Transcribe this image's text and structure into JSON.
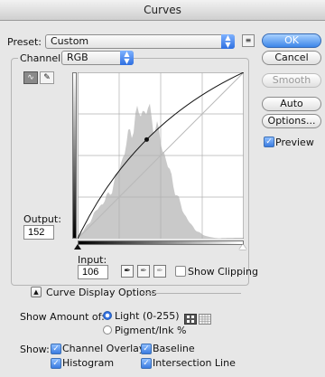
{
  "window": {
    "title": "Curves"
  },
  "preset": {
    "label": "Preset:",
    "value": "Custom"
  },
  "channel": {
    "label": "Channel:",
    "value": "RGB"
  },
  "buttons": {
    "ok": "OK",
    "cancel": "Cancel",
    "smooth": "Smooth",
    "auto": "Auto",
    "options": "Options..."
  },
  "preview": {
    "label": "Preview",
    "checked": true
  },
  "output": {
    "label": "Output:",
    "value": "152"
  },
  "input": {
    "label": "Input:",
    "value": "106"
  },
  "show_clipping": {
    "label": "Show Clipping",
    "checked": false
  },
  "display_options": {
    "label": "Curve Display Options"
  },
  "show_amount": {
    "label": "Show Amount of:",
    "light": "Light  (0-255)",
    "pigment": "Pigment/Ink %",
    "selected": "light"
  },
  "show": {
    "label": "Show:",
    "channel_overlays": "Channel Overlays",
    "baseline": "Baseline",
    "histogram": "Histogram",
    "intersection_line": "Intersection Line"
  },
  "curve_point": {
    "input": 106,
    "output": 152
  },
  "colors": {
    "accent": "#3a7be0",
    "histogram": "#c9c9c9"
  }
}
